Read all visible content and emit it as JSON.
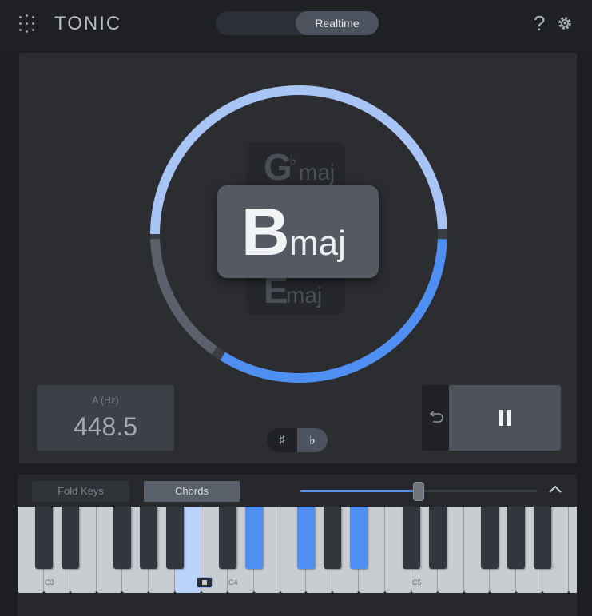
{
  "header": {
    "app_name": "TONIC",
    "mode_toggle": {
      "left_label": "",
      "right_label": "Realtime",
      "selected": "Realtime"
    },
    "help_label": "?"
  },
  "detector": {
    "current_chord": {
      "root": "B",
      "quality": "maj"
    },
    "previous_chord": {
      "root": "G",
      "accidental": "♭",
      "quality": "maj"
    },
    "next_chord": {
      "root": "E",
      "quality": "maj"
    }
  },
  "reference": {
    "label": "A (Hz)",
    "value": "448.5"
  },
  "accidentals": {
    "sharp": "♯",
    "flat": "♭",
    "selected": "flat"
  },
  "transport": {
    "undo_icon": "undo-icon",
    "pause_icon": "pause-icon"
  },
  "keyboard_controls": {
    "fold_keys_label": "Fold Keys",
    "chords_label": "Chords",
    "selected_tab": "Chords",
    "slider_value": 0.5
  },
  "keyboard": {
    "octave_labels": [
      "C3",
      "C4",
      "C5"
    ],
    "highlighted_white_keys": [
      "B"
    ],
    "highlighted_black_keys": [
      "D#",
      "F#",
      "A#"
    ],
    "colors": {
      "highlight": "#4f8ff2",
      "highlight_light": "#bcd4fb"
    }
  },
  "colors": {
    "accent": "#5a8fe0",
    "ring_light": "#a7c4f5",
    "ring_bright": "#4f8ff2",
    "ring_dim": "#5b606b"
  }
}
